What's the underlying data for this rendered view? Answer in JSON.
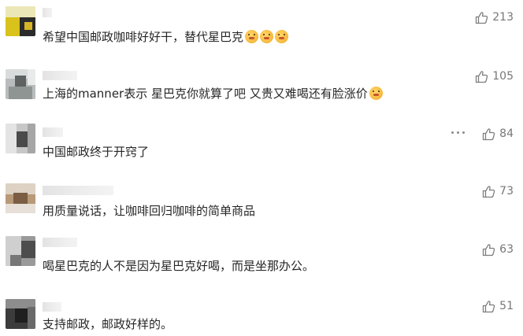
{
  "comments": [
    {
      "text": "希望中国邮政咖啡好好干，替代星巴克",
      "emoji_count": 3,
      "emoji_name": "shushing-face",
      "likes": "213"
    },
    {
      "text": "上海的manner表示 星巴克你就算了吧 又贵又难喝还有脸涨价",
      "emoji_count": 1,
      "emoji_name": "shushing-face",
      "likes": "105"
    },
    {
      "text": "中国邮政终于开窍了",
      "likes": "84"
    },
    {
      "text": "用质量说话，让咖啡回归咖啡的简单商品",
      "likes": "73"
    },
    {
      "text": "喝星巴克的人不是因为星巴克好喝，而是坐那办公。",
      "likes": "63"
    },
    {
      "text": "支持邮政，邮政好样的。",
      "likes": "51"
    }
  ],
  "icons": {
    "like": "thumbs-up-icon",
    "more": "more-dots-icon"
  },
  "colors": {
    "text": "#262626",
    "meta": "#777777",
    "background": "#ffffff"
  }
}
